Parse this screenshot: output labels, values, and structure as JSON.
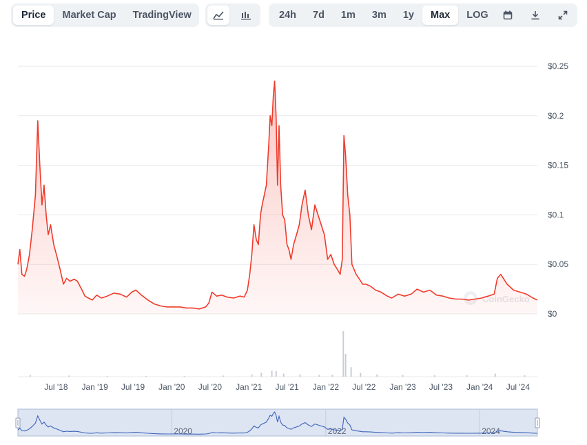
{
  "toolbar": {
    "view_tabs": [
      "Price",
      "Market Cap",
      "TradingView"
    ],
    "active_view": "Price",
    "chart_types": [
      "line-chart-icon",
      "candlestick-chart-icon"
    ],
    "active_chart_type": "line-chart-icon",
    "ranges": [
      "24h",
      "7d",
      "1m",
      "3m",
      "1y",
      "Max"
    ],
    "active_range": "Max",
    "log_label": "LOG",
    "calendar_icon": "calendar-icon",
    "download_icon": "download-icon",
    "fullscreen_icon": "expand-icon"
  },
  "watermark": "CoinGecko",
  "colors": {
    "price_line": "#ef3b2c",
    "price_fill": "#fde2e0",
    "volume": "#c9ced6",
    "navigator_fill": "#dde5f3",
    "navigator_line": "#3d62b8",
    "grid": "#e8eaee",
    "button_bg": "#eff2f5"
  },
  "chart_data": {
    "type": "area",
    "title": "",
    "xlabel": "",
    "ylabel": "",
    "ylim": [
      0,
      0.25
    ],
    "yticks": [
      0,
      0.05,
      0.1,
      0.15,
      0.2,
      0.25
    ],
    "ytick_labels": [
      "$0",
      "$0.05",
      "$0.1",
      "$0.15",
      "$0.2",
      "$0.25"
    ],
    "xlim": [
      "2018-01-01",
      "2024-10-01"
    ],
    "xtick_dates": [
      "2018-07-01",
      "2019-01-01",
      "2019-07-01",
      "2020-01-01",
      "2020-07-01",
      "2021-01-01",
      "2021-07-01",
      "2022-01-01",
      "2022-07-01",
      "2023-01-01",
      "2023-07-01",
      "2024-01-01",
      "2024-07-01"
    ],
    "xtick_labels": [
      "Jul '18",
      "Jan '19",
      "Jul '19",
      "Jan '20",
      "Jul '20",
      "Jan '21",
      "Jul '21",
      "Jan '22",
      "Jul '22",
      "Jan '23",
      "Jul '23",
      "Jan '24",
      "Jul '24"
    ],
    "grid": true,
    "series": [
      {
        "kind": "price",
        "x": [
          "2018-01-01",
          "2018-01-10",
          "2018-01-20",
          "2018-02-01",
          "2018-02-12",
          "2018-02-25",
          "2018-03-10",
          "2018-03-25",
          "2018-04-05",
          "2018-04-15",
          "2018-04-25",
          "2018-05-05",
          "2018-05-15",
          "2018-05-25",
          "2018-06-05",
          "2018-06-20",
          "2018-07-05",
          "2018-07-20",
          "2018-08-05",
          "2018-08-20",
          "2018-09-05",
          "2018-09-25",
          "2018-10-10",
          "2018-10-30",
          "2018-11-15",
          "2018-12-01",
          "2018-12-20",
          "2019-01-10",
          "2019-02-01",
          "2019-03-01",
          "2019-04-01",
          "2019-05-01",
          "2019-06-01",
          "2019-06-25",
          "2019-07-15",
          "2019-08-10",
          "2019-09-10",
          "2019-10-10",
          "2019-11-10",
          "2019-12-10",
          "2020-01-10",
          "2020-02-10",
          "2020-03-10",
          "2020-04-10",
          "2020-05-10",
          "2020-06-10",
          "2020-06-25",
          "2020-07-10",
          "2020-08-01",
          "2020-08-25",
          "2020-09-20",
          "2020-10-20",
          "2020-11-20",
          "2020-12-10",
          "2020-12-25",
          "2021-01-05",
          "2021-01-15",
          "2021-01-25",
          "2021-02-05",
          "2021-02-15",
          "2021-02-25",
          "2021-03-05",
          "2021-03-15",
          "2021-03-25",
          "2021-04-05",
          "2021-04-12",
          "2021-04-20",
          "2021-04-27",
          "2021-05-03",
          "2021-05-10",
          "2021-05-17",
          "2021-05-24",
          "2021-06-01",
          "2021-06-10",
          "2021-06-20",
          "2021-07-01",
          "2021-07-10",
          "2021-07-20",
          "2021-08-01",
          "2021-08-15",
          "2021-08-28",
          "2021-09-10",
          "2021-09-25",
          "2021-10-10",
          "2021-10-25",
          "2021-11-10",
          "2021-11-25",
          "2021-12-10",
          "2021-12-25",
          "2022-01-10",
          "2022-01-25",
          "2022-02-10",
          "2022-02-25",
          "2022-03-10",
          "2022-03-20",
          "2022-03-28",
          "2022-04-05",
          "2022-04-15",
          "2022-04-25",
          "2022-05-05",
          "2022-05-15",
          "2022-05-25",
          "2022-06-10",
          "2022-06-25",
          "2022-07-10",
          "2022-08-01",
          "2022-08-25",
          "2022-09-20",
          "2022-10-20",
          "2022-11-10",
          "2022-12-10",
          "2023-01-10",
          "2023-02-10",
          "2023-03-10",
          "2023-04-10",
          "2023-05-10",
          "2023-06-10",
          "2023-07-10",
          "2023-08-10",
          "2023-09-10",
          "2023-10-10",
          "2023-11-10",
          "2023-12-10",
          "2024-01-10",
          "2024-02-10",
          "2024-03-10",
          "2024-03-25",
          "2024-04-10",
          "2024-05-10",
          "2024-06-10",
          "2024-07-10",
          "2024-08-10",
          "2024-09-10",
          "2024-10-01"
        ],
        "y": [
          0.05,
          0.065,
          0.04,
          0.038,
          0.045,
          0.06,
          0.085,
          0.12,
          0.195,
          0.15,
          0.11,
          0.13,
          0.1,
          0.08,
          0.09,
          0.07,
          0.058,
          0.045,
          0.03,
          0.036,
          0.033,
          0.035,
          0.033,
          0.025,
          0.018,
          0.016,
          0.014,
          0.019,
          0.016,
          0.018,
          0.021,
          0.02,
          0.017,
          0.022,
          0.024,
          0.019,
          0.014,
          0.01,
          0.008,
          0.007,
          0.007,
          0.007,
          0.006,
          0.006,
          0.005,
          0.007,
          0.011,
          0.022,
          0.018,
          0.019,
          0.017,
          0.016,
          0.018,
          0.017,
          0.024,
          0.04,
          0.06,
          0.09,
          0.075,
          0.07,
          0.1,
          0.11,
          0.12,
          0.13,
          0.17,
          0.2,
          0.19,
          0.22,
          0.235,
          0.2,
          0.13,
          0.19,
          0.13,
          0.1,
          0.095,
          0.07,
          0.065,
          0.055,
          0.07,
          0.08,
          0.09,
          0.11,
          0.125,
          0.1,
          0.085,
          0.11,
          0.1,
          0.09,
          0.08,
          0.055,
          0.06,
          0.05,
          0.045,
          0.04,
          0.055,
          0.18,
          0.16,
          0.12,
          0.1,
          0.05,
          0.045,
          0.04,
          0.035,
          0.03,
          0.03,
          0.028,
          0.024,
          0.022,
          0.018,
          0.016,
          0.02,
          0.018,
          0.02,
          0.025,
          0.022,
          0.024,
          0.019,
          0.018,
          0.016,
          0.015,
          0.015,
          0.014,
          0.015,
          0.016,
          0.018,
          0.02,
          0.036,
          0.04,
          0.03,
          0.024,
          0.022,
          0.02,
          0.016,
          0.014
        ]
      },
      {
        "kind": "volume",
        "x": [
          "2018-03-01",
          "2018-09-01",
          "2019-03-01",
          "2019-09-01",
          "2020-03-01",
          "2020-09-01",
          "2021-01-15",
          "2021-03-01",
          "2021-04-20",
          "2021-05-10",
          "2021-06-15",
          "2021-09-01",
          "2021-12-01",
          "2022-02-01",
          "2022-03-25",
          "2022-04-05",
          "2022-05-01",
          "2022-06-15",
          "2022-09-01",
          "2023-01-01",
          "2023-06-01",
          "2023-11-01",
          "2024-03-15",
          "2024-08-01"
        ],
        "y": [
          0.4,
          0.3,
          0.2,
          0.2,
          0.2,
          0.3,
          0.6,
          1.0,
          1.6,
          1.5,
          0.8,
          0.6,
          0.5,
          0.5,
          12.0,
          6.0,
          2.5,
          1.0,
          0.6,
          0.5,
          0.4,
          0.4,
          0.8,
          0.4
        ]
      }
    ],
    "navigator": {
      "xtick_labels": [
        "2020",
        "2022",
        "2024"
      ],
      "xtick_dates": [
        "2020-01-01",
        "2022-01-01",
        "2024-01-01"
      ]
    }
  }
}
